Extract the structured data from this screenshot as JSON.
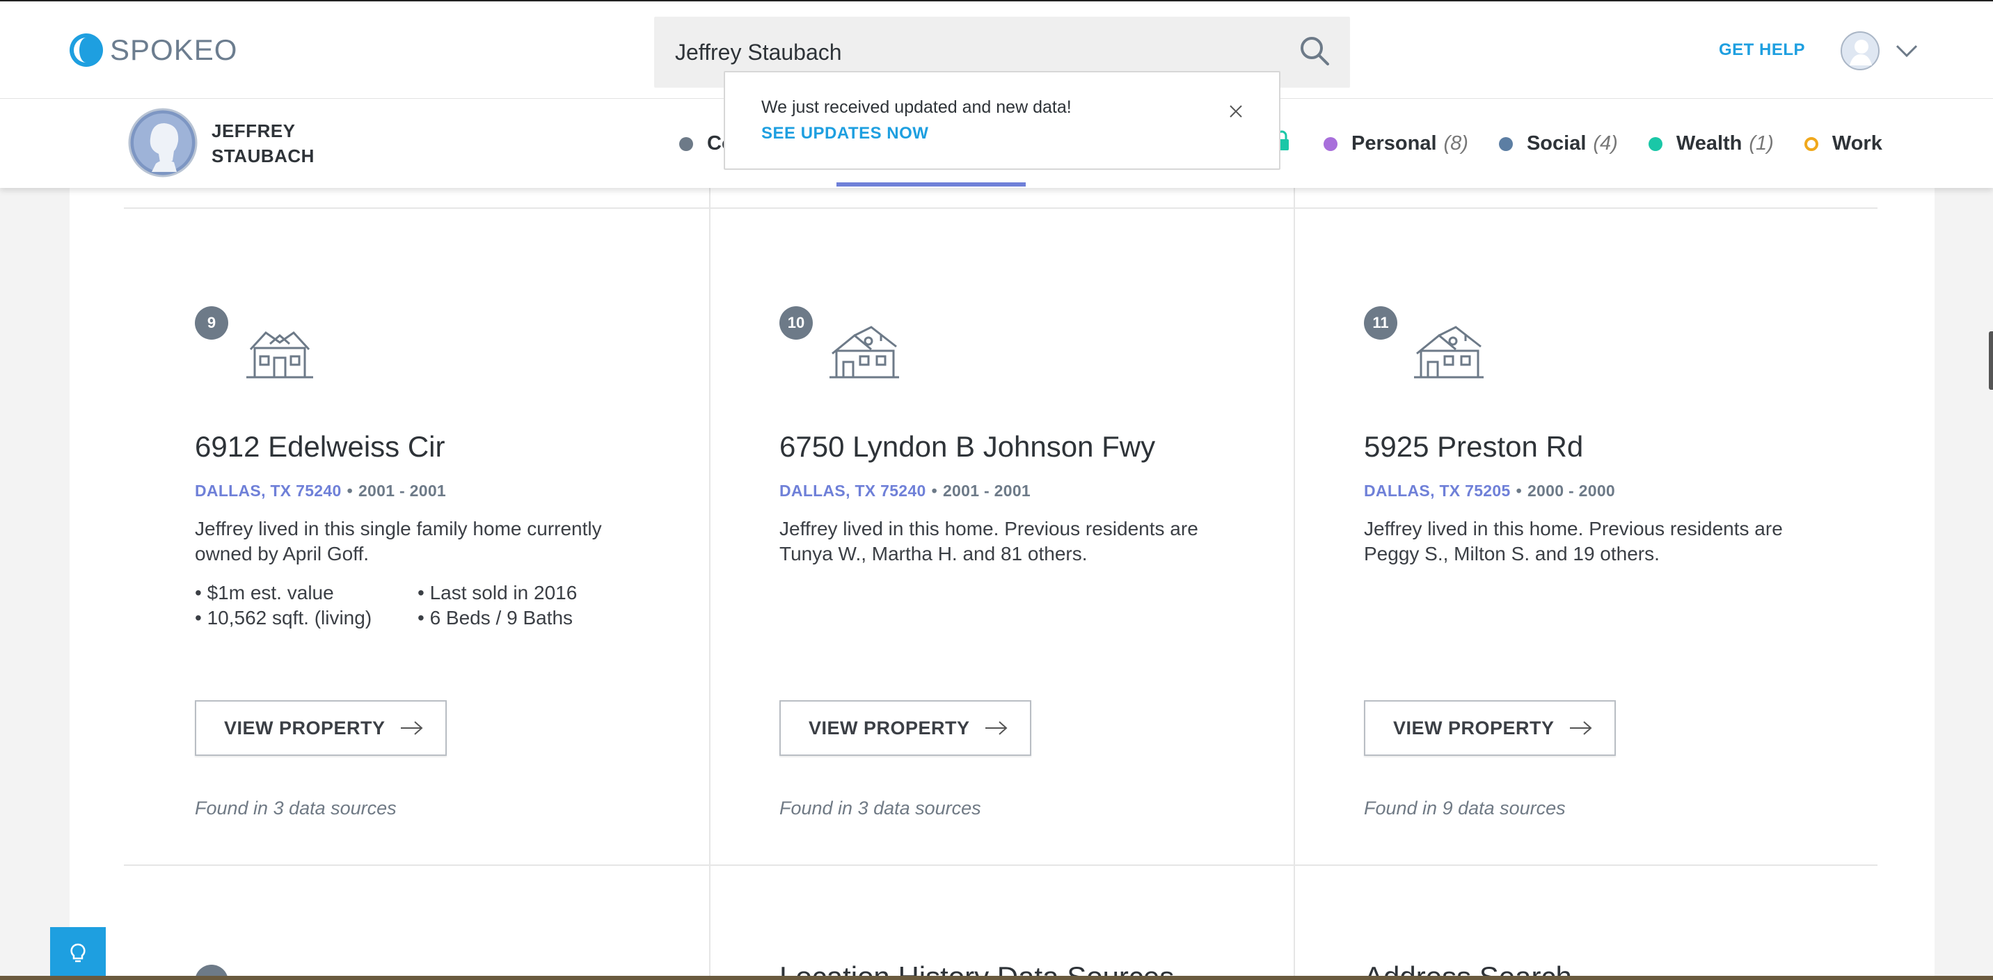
{
  "header": {
    "logo_text": "SPOKEO",
    "search_value": "Jeffrey Staubach",
    "get_help": "GET HELP"
  },
  "profile": {
    "name": "JEFFREY STAUBACH",
    "partial_category": "Co"
  },
  "categories": [
    {
      "label": "Personal",
      "count": "(8)",
      "color": "#a86fdb",
      "style": "filled"
    },
    {
      "label": "Social",
      "count": "(4)",
      "color": "#5c7ea3",
      "style": "filled"
    },
    {
      "label": "Wealth",
      "count": "(1)",
      "color": "#1ac7a7",
      "style": "filled"
    },
    {
      "label": "Work",
      "count": "",
      "color": "#f0a81c",
      "style": "ring"
    }
  ],
  "colors": {
    "accent_blue": "#1e9fe0",
    "location_purple": "#6f80d8",
    "lock_green": "#1ac7a7",
    "partial_category_dot": "#6d7a88"
  },
  "popup": {
    "message": "We just received updated and new data!",
    "link": "SEE UPDATES NOW"
  },
  "cards": [
    {
      "number": "9",
      "title": "6912 Edelweiss Cir",
      "location": "DALLAS, TX 75240",
      "years": "2001 - 2001",
      "description": "Jeffrey lived in this single family home currently owned by April Goff.",
      "facts": [
        "• $1m est. value",
        "• Last sold in 2016",
        "• 10,562 sqft. (living)",
        "• 6 Beds / 9 Baths"
      ],
      "button": "VIEW PROPERTY",
      "sources": "Found in 3 data sources",
      "icon": "house-icon"
    },
    {
      "number": "10",
      "title": "6750 Lyndon B Johnson Fwy",
      "location": "DALLAS, TX 75240",
      "years": "2001 - 2001",
      "description": "Jeffrey lived in this home. Previous residents are Tunya W., Martha H. and 81 others.",
      "facts": [],
      "button": "VIEW PROPERTY",
      "sources": "Found in 3 data sources",
      "icon": "house-icon"
    },
    {
      "number": "11",
      "title": "5925 Preston Rd",
      "location": "DALLAS, TX 75205",
      "years": "2000 - 2000",
      "description": "Jeffrey lived in this home. Previous residents are Peggy S., Milton S. and 19 others.",
      "facts": [],
      "button": "VIEW PROPERTY",
      "sources": "Found in 9 data sources",
      "icon": "house-icon"
    }
  ],
  "bottom_row": {
    "col2_title": "Location History Data Sources",
    "col3_title": "Address Search"
  },
  "meta_separator": "•"
}
